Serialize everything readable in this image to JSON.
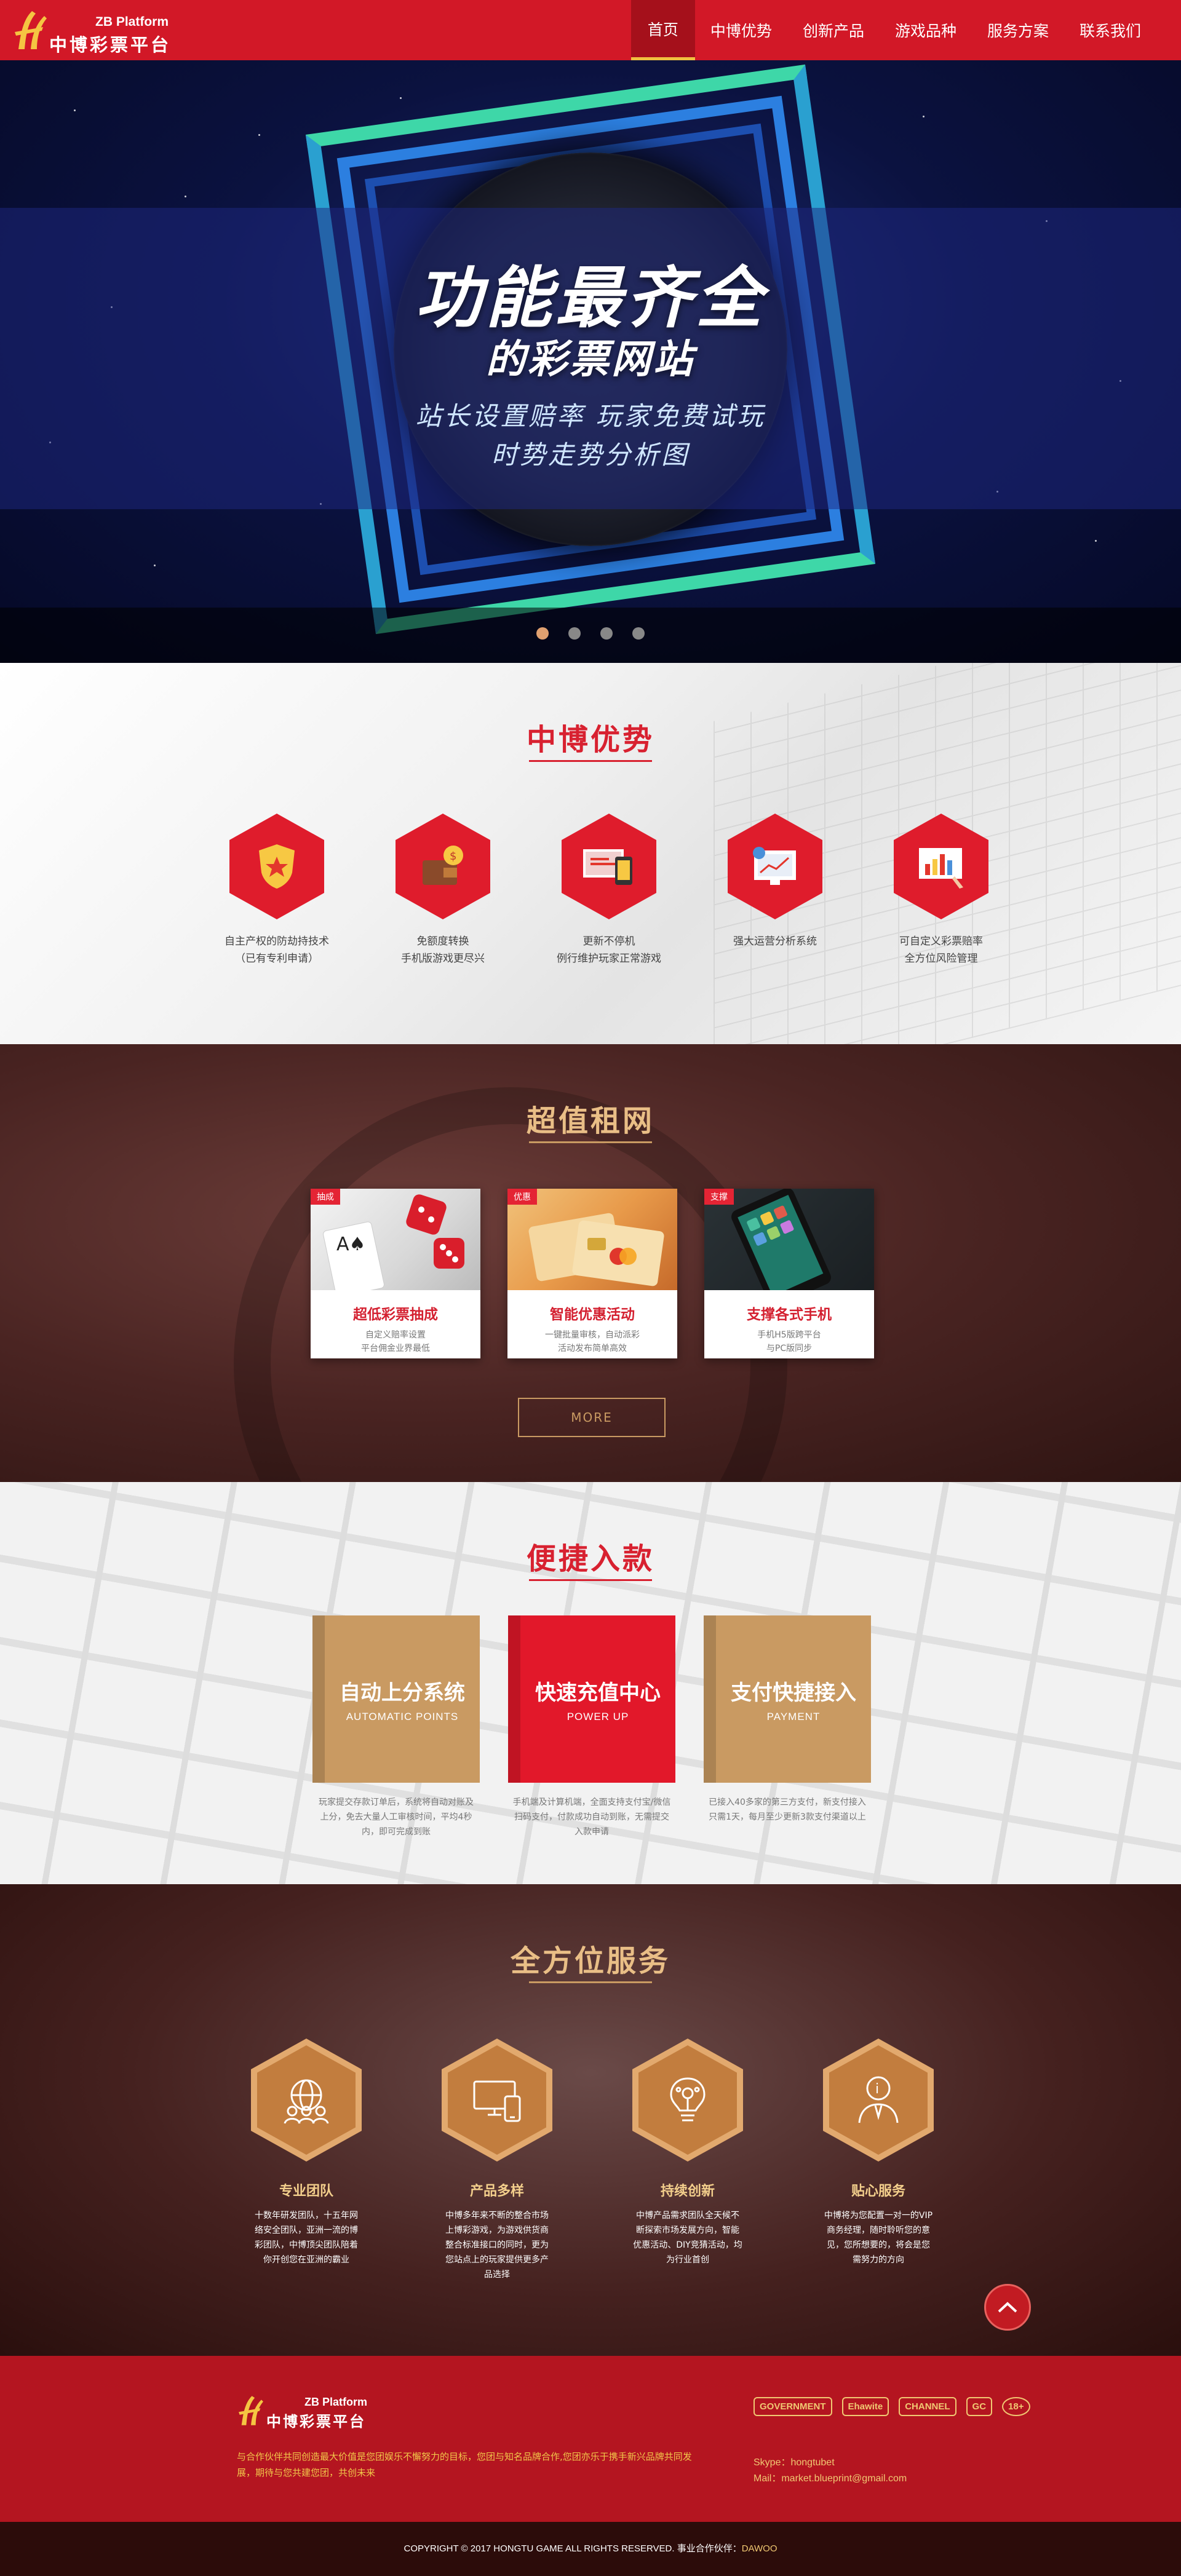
{
  "nav": {
    "logo_sub": "ZB Platform",
    "logo_main": "中博彩票平台",
    "items": [
      {
        "label": "首页",
        "active": true
      },
      {
        "label": "中博优势",
        "active": false
      },
      {
        "label": "创新产品",
        "active": false
      },
      {
        "label": "游戏品种",
        "active": false
      },
      {
        "label": "服务方案",
        "active": false
      },
      {
        "label": "联系我们",
        "active": false
      }
    ]
  },
  "hero": {
    "title1": "功能最齐全",
    "title2": "的彩票网站",
    "sub1": "站长设置赔率  玩家免费试玩",
    "sub2": "时势走势分析图",
    "slides": 4,
    "active_slide": 0
  },
  "advantage": {
    "title": "中博优势",
    "items": [
      {
        "icon": "shield-star-icon",
        "line1": "自主产权的防劫持技术",
        "line2": "（已有专利申请）"
      },
      {
        "icon": "wallet-coin-icon",
        "line1": "免额度转换",
        "line2": "手机版游戏更尽兴"
      },
      {
        "icon": "monitor-phone-icon",
        "line1": "更新不停机",
        "line2": "例行维护玩家正常游戏"
      },
      {
        "icon": "analytics-screen-icon",
        "line1": "强大运营分析系统",
        "line2": ""
      },
      {
        "icon": "chart-board-icon",
        "line1": "可自定义彩票赔率",
        "line2": "全方位风险管理"
      }
    ]
  },
  "rent": {
    "title": "超值租网",
    "cards": [
      {
        "tag": "抽成",
        "title": "超低彩票抽成",
        "desc1": "自定义赔率设置",
        "desc2": "平台佣金业界最低"
      },
      {
        "tag": "优惠",
        "title": "智能优惠活动",
        "desc1": "一键批量审核，自动派彩",
        "desc2": "活动发布简单高效"
      },
      {
        "tag": "支撑",
        "title": "支撑各式手机",
        "desc1": "手机H5版跨平台",
        "desc2": "与PC版同步"
      }
    ],
    "more_label": "MORE"
  },
  "deposit": {
    "title": "便捷入款",
    "cards": [
      {
        "zh": "自动上分系统",
        "en": "AUTOMATIC POINTS",
        "color": "#c99a62",
        "text": "玩家提交存款订单后，系统将自动对账及上分，免去大量人工审核时间，平均4秒内，即可完成到账"
      },
      {
        "zh": "快速充值中心",
        "en": "POWER UP",
        "color": "#e2182a",
        "text": "手机端及计算机端，全面支持支付宝/微信扫码支付，付款成功自动到账，无需提交入款申请"
      },
      {
        "zh": "支付快捷接入",
        "en": "PAYMENT",
        "color": "#c99a62",
        "text": "已接入40多家的第三方支付，新支付接入只需1天，每月至少更新3款支付渠道以上"
      }
    ]
  },
  "service": {
    "title": "全方位服务",
    "items": [
      {
        "icon": "team-globe-icon",
        "title": "专业团队",
        "text": "十数年研发团队，十五年网络安全团队，亚洲一流的博彩团队，中博顶尖团队陪着你开创您在亚洲的霸业"
      },
      {
        "icon": "devices-icon",
        "title": "产品多样",
        "text": "中博多年来不断的整合市场上博彩游戏，为游戏供货商整合标准接口的同时，更为您站点上的玩家提供更多产品选择"
      },
      {
        "icon": "idea-bulb-icon",
        "title": "持续创新",
        "text": "中博产品需求团队全天候不断探索市场发展方向，智能优惠活动、DIY竞猜活动，均为行业首创"
      },
      {
        "icon": "support-agent-icon",
        "title": "贴心服务",
        "text": "中博将为您配置一对一的VIP商务经理，随时聆听您的意见，您所想要的，将会是您需努力的方向"
      }
    ]
  },
  "footer": {
    "logo_sub": "ZB Platform",
    "logo_main": "中博彩票平台",
    "text": "与合作伙伴共同创造最大价值是您团娱乐不懈努力的目标，您团与知名品牌合作,您团亦乐于携手新兴品牌共同发展，期待与您共建您团，共创未来",
    "partners": [
      "GOVERNMENT",
      "Ehawite",
      "CHANNEL",
      "GC",
      "18+"
    ],
    "skype": "Skype：hongtubet",
    "mail": "Mail：market.blueprint@gmail.com",
    "copyright": "COPYRIGHT © 2017 HONGTU GAME ALL RIGHTS RESERVED.  事业合作伙伴：",
    "partner_name": "DAWOO"
  }
}
